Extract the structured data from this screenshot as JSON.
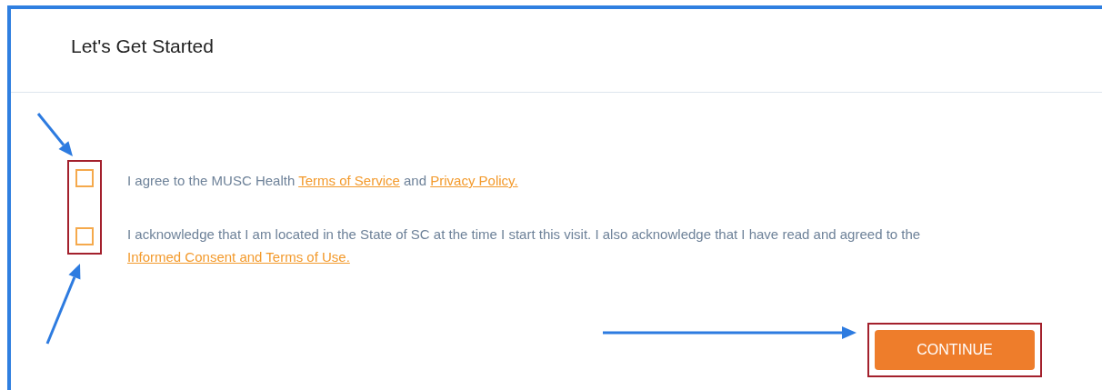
{
  "dialog": {
    "title": "Let's Get Started"
  },
  "agreements": [
    {
      "checked": false,
      "segments": [
        {
          "kind": "text",
          "text": "I agree to the MUSC Health "
        },
        {
          "kind": "link",
          "text": "Terms of Service"
        },
        {
          "kind": "text",
          "text": " and "
        },
        {
          "kind": "link",
          "text": "Privacy Policy."
        }
      ]
    },
    {
      "checked": false,
      "segments": [
        {
          "kind": "text",
          "text": "I acknowledge that I am located in the State of SC at the time I start this visit. I also acknowledge that I have read and agreed to the "
        },
        {
          "kind": "link",
          "text": "Informed Consent and Terms of Use."
        }
      ]
    }
  ],
  "continue_button": {
    "label": "CONTINUE"
  }
}
